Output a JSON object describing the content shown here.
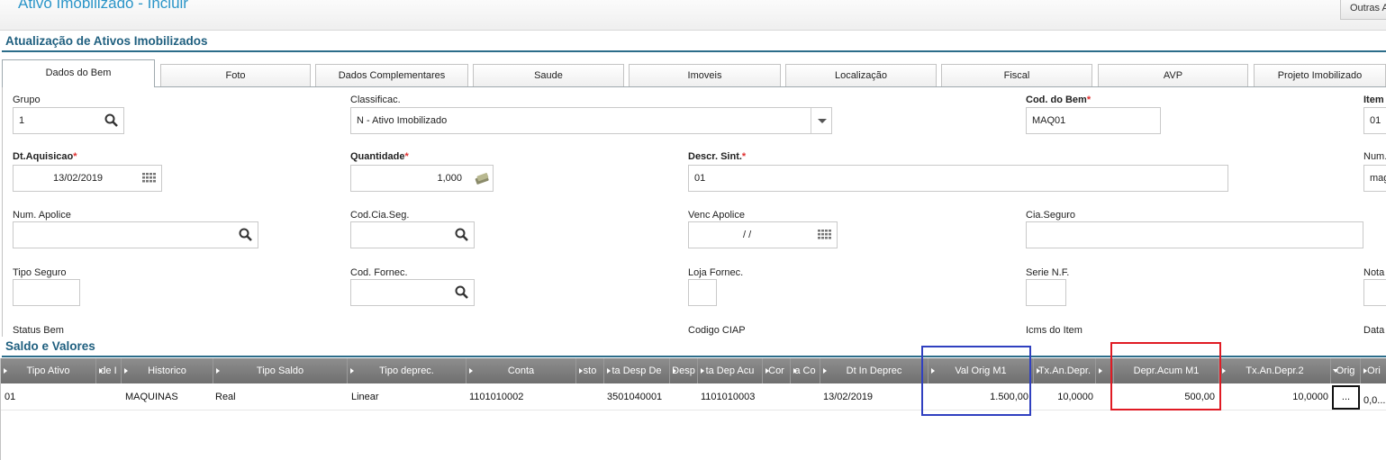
{
  "window": {
    "title": "Ativo Imobilizado - Incluir",
    "outras_label": "Outras A"
  },
  "section_main": {
    "title": "Atualização de Ativos Imobilizados"
  },
  "tabs": [
    {
      "label": "Dados do Bem"
    },
    {
      "label": "Foto"
    },
    {
      "label": "Dados Complementares"
    },
    {
      "label": "Saude"
    },
    {
      "label": "Imoveis"
    },
    {
      "label": "Localização"
    },
    {
      "label": "Fiscal"
    },
    {
      "label": "AVP"
    },
    {
      "label": "Projeto Imobilizado"
    }
  ],
  "form": {
    "grupo": {
      "label": "Grupo",
      "value": "1"
    },
    "classificac": {
      "label": "Classificac.",
      "value": "N - Ativo Imobilizado"
    },
    "cod_bem": {
      "label": "Cod. do Bem",
      "value": "MAQ01"
    },
    "item": {
      "label": "Item",
      "value": "01"
    },
    "dt_aquisicao": {
      "label": "Dt.Aquisicao",
      "value": "13/02/2019"
    },
    "quantidade": {
      "label": "Quantidade",
      "value": "1,000"
    },
    "descr_sint": {
      "label": "Descr. Sint.",
      "value": "01"
    },
    "num_placa": {
      "label": "Num.I",
      "value": "mag"
    },
    "num_apolice": {
      "label": "Num. Apolice",
      "value": ""
    },
    "cod_cia_seg": {
      "label": "Cod.Cia.Seg.",
      "value": ""
    },
    "venc_apolice": {
      "label": "Venc Apolice",
      "value": "/ /"
    },
    "cia_seguro": {
      "label": "Cia.Seguro",
      "value": ""
    },
    "tipo_seguro": {
      "label": "Tipo Seguro",
      "value": ""
    },
    "cod_fornec": {
      "label": "Cod. Fornec.",
      "value": ""
    },
    "loja_fornec": {
      "label": "Loja Fornec.",
      "value": ""
    },
    "serie_nf": {
      "label": "Serie N.F.",
      "value": ""
    },
    "nota": {
      "label": "Nota",
      "value": ""
    },
    "status_bem": {
      "label": "Status Bem"
    },
    "codigo_ciap": {
      "label": "Codigo CIAP"
    },
    "icms_item": {
      "label": "Icms do Item"
    },
    "data": {
      "label": "Data"
    },
    "required_mark": "*"
  },
  "section_saldo": {
    "title": "Saldo e Valores"
  },
  "grid": {
    "columns": [
      "Tipo Ativo",
      "de I",
      "Historico",
      "Tipo Saldo",
      "Tipo deprec.",
      "Conta",
      "sto",
      "ta Desp De",
      "Desp",
      "ta Dep Acu",
      "Cor",
      "a Co",
      "Dt In Deprec",
      "Val Orig M1",
      "Tx.An.Depr.",
      "",
      "Depr.Acum M1",
      "Tx.An.Depr.2",
      "Orig",
      "Ori"
    ],
    "row": {
      "tipo_ativo": "01",
      "historico": "MAQUINAS",
      "tipo_saldo": "Real",
      "tipo_deprec": "Linear",
      "conta": "1101010002",
      "conta_desp": "3501040001",
      "conta_dep_acu": "1101010003",
      "dt_in_deprec": "13/02/2019",
      "val_orig_m1": "1.500,00",
      "tx_an_depr": "10,0000",
      "depr_acum_m1": "500,00",
      "tx_an_depr2": "10,0000",
      "ellipsis": "...",
      "orig_val": "0,0..."
    }
  },
  "colors": {
    "accent_title": "#2b95c8",
    "section_title": "#1f5f7f",
    "highlight_blue": "#3040c0",
    "highlight_red": "#e01b24"
  }
}
